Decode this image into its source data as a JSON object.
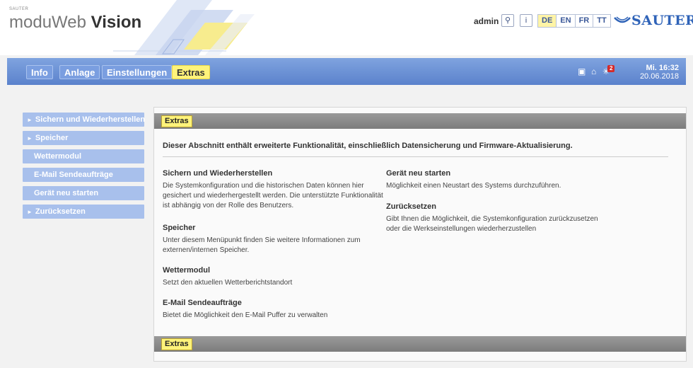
{
  "header": {
    "brand_small": "SAUTER",
    "brand_light": "moduWeb",
    "brand_bold": "Vision",
    "user": "admin",
    "languages": [
      "DE",
      "EN",
      "FR",
      "TT"
    ],
    "active_language": "DE",
    "logo_text": "SAUTER",
    "logo_color": "#2f63b8"
  },
  "nav": {
    "tabs": [
      "Info",
      "Anlage",
      "Einstellungen",
      "Extras"
    ],
    "active_tab": "Extras",
    "alarm_count": "2",
    "time": "Mi. 16:32",
    "date": "20.06.2018",
    "accent": "#6b8fd6",
    "highlight": "#fff37a"
  },
  "sidebar": {
    "items": [
      {
        "label": "Sichern und Wiederherstellen",
        "expandable": true
      },
      {
        "label": "Speicher",
        "expandable": true
      },
      {
        "label": "Wettermodul",
        "expandable": false
      },
      {
        "label": "E-Mail Sendeaufträge",
        "expandable": false
      },
      {
        "label": "Gerät neu starten",
        "expandable": false
      },
      {
        "label": "Zurücksetzen",
        "expandable": true
      }
    ]
  },
  "content": {
    "breadcrumb_top": "Extras",
    "breadcrumb_bottom": "Extras",
    "intro": "Dieser Abschnitt enthält erweiterte Funktionalität, einschließlich Datensicherung und Firmware-Aktualisierung.",
    "left_sections": [
      {
        "title": "Sichern und Wiederherstellen",
        "text": "Die Systemkonfiguration und die historischen Daten können hier gesichert und wiederhergestellt werden. Die unterstützte Funktionalität ist abhängig von der Rolle des Benutzers."
      },
      {
        "title": "Speicher",
        "text": "Unter diesem Menüpunkt finden Sie weitere Informationen zum externen/internen Speicher."
      },
      {
        "title": "Wettermodul",
        "text": "Setzt den aktuellen Wetterberichtstandort"
      },
      {
        "title": "E-Mail Sendeaufträge",
        "text": "Bietet die Möglichkeit den E-Mail Puffer zu verwalten"
      }
    ],
    "right_sections": [
      {
        "title": "Gerät neu starten",
        "text": "Möglichkeit einen Neustart des Systems durchzuführen."
      },
      {
        "title": "Zurücksetzen",
        "text": "Gibt Ihnen die Möglichkeit, die Systemkonfiguration zurückzusetzen oder die Werkseinstellungen wiederherzustellen"
      }
    ]
  }
}
